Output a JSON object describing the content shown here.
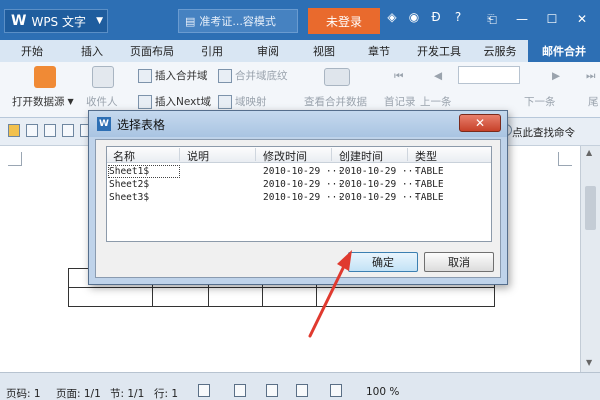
{
  "titlebar": {
    "app_name": "WPS 文字",
    "logo_glyph": "W",
    "doc_tab": "准考证...容模式",
    "login_label": "未登录",
    "help_glyph": "?",
    "window_controls": [
      "⎗",
      "—",
      "☐",
      "✕"
    ]
  },
  "tabs": [
    "开始",
    "插入",
    "页面布局",
    "引用",
    "审阅",
    "视图",
    "章节",
    "开发工具",
    "云服务",
    "邮件合并"
  ],
  "ribbon": {
    "open_source": "打开数据源",
    "recipient": "收件人",
    "insert_merge_field": "插入合并域",
    "merge_field_shading": "合并域底纹",
    "insert_next_field": "插入Next域",
    "field_mapping": "域映射",
    "view_merged_data": "查看合并数据",
    "first_record": "首记录",
    "prev_record": "上一条",
    "next_record": "下一条",
    "last_record": "尾"
  },
  "quick": {
    "find_command": "点此查找命令"
  },
  "dialog": {
    "title": "选择表格",
    "columns": [
      "名称",
      "说明",
      "修改时间",
      "创建时间",
      "类型"
    ],
    "rows": [
      {
        "name": "Sheet1$",
        "desc": "",
        "modified": "2010-10-29 ···",
        "created": "2010-10-29 ···",
        "type": "TABLE"
      },
      {
        "name": "Sheet2$",
        "desc": "",
        "modified": "2010-10-29 ···",
        "created": "2010-10-29 ···",
        "type": "TABLE"
      },
      {
        "name": "Sheet3$",
        "desc": "",
        "modified": "2010-10-29 ···",
        "created": "2010-10-29 ···",
        "type": "TABLE"
      }
    ],
    "ok_label": "确定",
    "cancel_label": "取消",
    "close_glyph": "✕"
  },
  "statusbar": {
    "page_num": "页码: 1",
    "pages": "页面: 1/1",
    "section": "节: 1/1",
    "line": "行: 1",
    "zoom": "100 %"
  },
  "colors": {
    "titlebar": "#2d6fb4",
    "active_tab": "#2d6fb4",
    "login": "#e96a2d",
    "arrow": "#e03a2f"
  }
}
